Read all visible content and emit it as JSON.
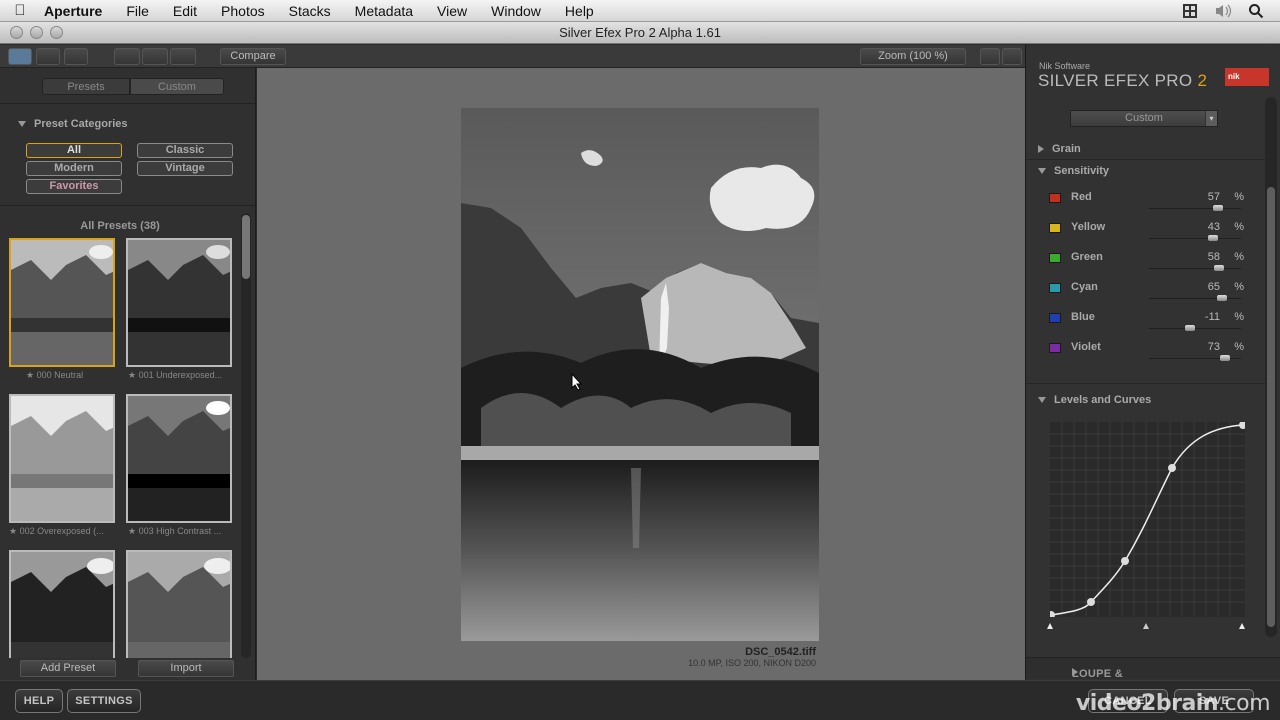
{
  "menubar": {
    "app": "Aperture",
    "items": [
      "File",
      "Edit",
      "Photos",
      "Stacks",
      "Metadata",
      "View",
      "Window",
      "Help"
    ]
  },
  "window": {
    "title": "Silver Efex Pro 2 Alpha 1.61"
  },
  "toolbar": {
    "compare": "Compare",
    "zoom": "Zoom (100 %)"
  },
  "left": {
    "tabs": [
      "Presets",
      "Custom"
    ],
    "categories_title": "Preset Categories",
    "categories": [
      "All",
      "Classic",
      "Modern",
      "Vintage",
      "Favorites"
    ],
    "presets_title": "All Presets (38)",
    "presets": [
      "000 Neutral",
      "001 Underexposed...",
      "002 Overexposed (...",
      "003 High Contrast ..."
    ],
    "add_preset": "Add Preset",
    "import": "Import"
  },
  "file": {
    "name": "DSC_0542.tiff",
    "meta": "10.0 MP, ISO 200, NIKON D200"
  },
  "right": {
    "brand_small": "Nik Software",
    "brand_main": "SILVER EFEX PRO",
    "brand_num": "2",
    "logo": "nik",
    "dropdown": "Custom",
    "grain": "Grain",
    "sensitivity": "Sensitivity",
    "sens": [
      {
        "name": "Red",
        "value": "57",
        "color": "#c0301f",
        "level": 0.57
      },
      {
        "name": "Yellow",
        "value": "43",
        "color": "#d6b51e",
        "level": 0.43
      },
      {
        "name": "Green",
        "value": "58",
        "color": "#3caa2c",
        "level": 0.58
      },
      {
        "name": "Cyan",
        "value": "65",
        "color": "#2b99a9",
        "level": 0.65
      },
      {
        "name": "Blue",
        "value": "-11",
        "color": "#1f3fae",
        "level": -0.11
      },
      {
        "name": "Violet",
        "value": "73",
        "color": "#7c2ca3",
        "level": 0.73
      }
    ],
    "pct": "%",
    "levels_title": "Levels and Curves",
    "loupe": "LOUPE & HISTOGRAM"
  },
  "bottom": {
    "help": "HELP",
    "settings": "SETTINGS",
    "cancel": "CANCEL",
    "save": "SAVE",
    "watermark_a": "video2brain",
    "watermark_b": ".com"
  }
}
